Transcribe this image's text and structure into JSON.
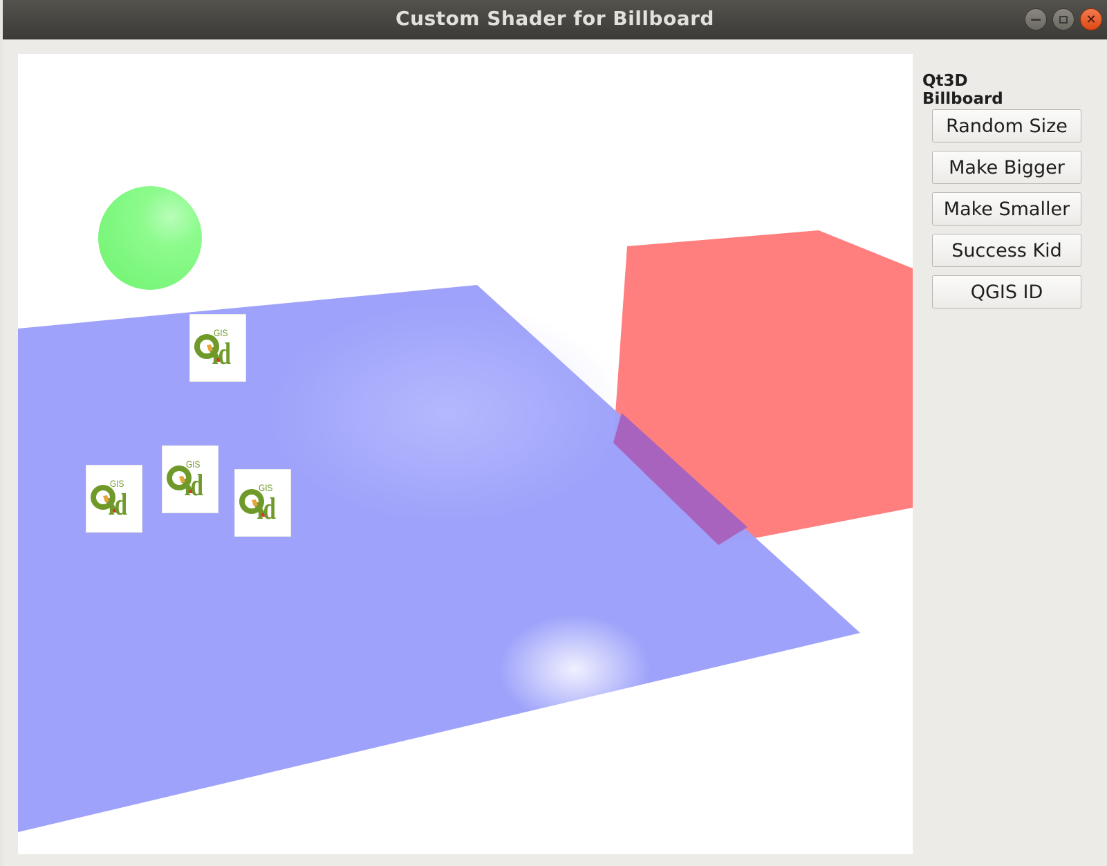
{
  "window": {
    "title": "Custom Shader for Billboard",
    "controls": [
      "minimize-icon",
      "maximize-icon",
      "close-icon"
    ]
  },
  "panel": {
    "heading": "Qt3D Billboard",
    "buttons": [
      {
        "label": "Random Size"
      },
      {
        "label": "Make Bigger"
      },
      {
        "label": "Make Smaller"
      },
      {
        "label": "Success Kid"
      },
      {
        "label": "QGIS ID"
      }
    ]
  },
  "scene": {
    "background": "#ffffff",
    "objects": [
      {
        "kind": "sphere",
        "color": "#7dfa7d"
      },
      {
        "kind": "plane",
        "color": "#9b9ffa"
      },
      {
        "kind": "cube",
        "color": "#ff7f7f"
      }
    ],
    "billboard_texture": {
      "logo_letters": "Qid",
      "logo_small_text": "GIS"
    },
    "billboard_count": 4
  },
  "colors": {
    "titlebar": "#3c3b37",
    "window_bg": "#edebe7",
    "close_button": "#e95420"
  }
}
